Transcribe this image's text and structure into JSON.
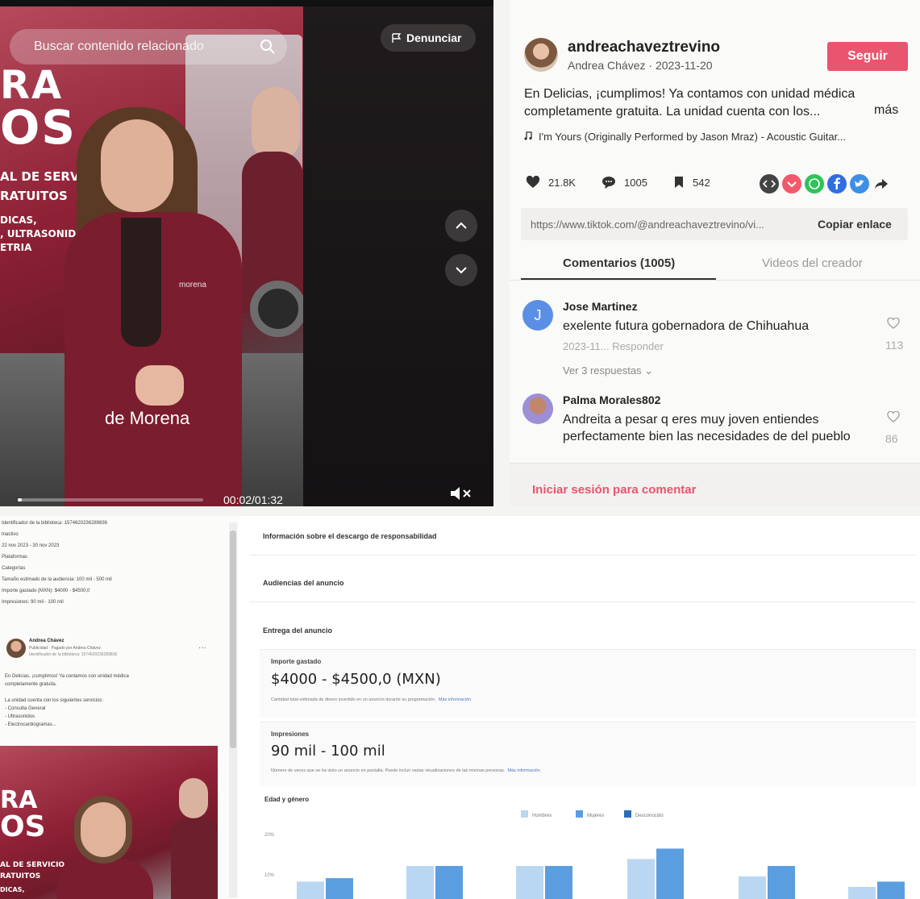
{
  "video": {
    "search_placeholder": "Buscar contenido relacionado",
    "report_label": "Denunciar",
    "caption": "de Morena",
    "time": "00:02/01:32",
    "progress": 0.02,
    "banner": {
      "ra": "RA",
      "os": "OS",
      "line1": "AL DE SERVICIO",
      "line2": "RATUITOS",
      "line3": "DICAS,",
      "line4": ", ULTRASONID",
      "line5": "ETRIA"
    },
    "jacket_text": "morena"
  },
  "post": {
    "username": "andreachaveztrevino",
    "subtitle": "Andrea Chávez · 2023-11-20",
    "follow_label": "Seguir",
    "description": "En Delicias, ¡cumplimos! Ya contamos con unidad médica completamente gratuita. La unidad cuenta con los...",
    "more_label": "más",
    "music": "I'm Yours (Originally Performed by Jason Mraz) - Acoustic Guitar...",
    "likes": "21.8K",
    "comments": "1005",
    "saves": "542",
    "link": "https://www.tiktok.com/@andreachaveztrevino/vi...",
    "copy_label": "Copiar enlace",
    "tabs": [
      "Comentarios (1005)",
      "Videos del creador"
    ],
    "comment_list": [
      {
        "initial": "J",
        "name": "Jose Martinez",
        "text": "exelente futura gobernadora de Chihuahua",
        "meta": "2023-11... Responder",
        "replies": "Ver 3 respuestas ⌄",
        "likes": "113"
      },
      {
        "initial": "",
        "name": "Palma Morales802",
        "text": "Andreita a pesar q eres muy joven entiendes perfectamente bien las necesidades de del pueblo",
        "meta": "",
        "replies": "",
        "likes": "86"
      }
    ],
    "login_label": "Iniciar sesión para comentar"
  },
  "library": {
    "lines": [
      "Identificador de la biblioteca: 1574620236289836",
      "Inactivo",
      "22 nov 2023 - 30 nov 2023",
      "Plataformas",
      "Categorías",
      "Tamaño estimado de la audiencia: 100 mil - 500 mil",
      "Importe gastado (MXN): $4000 - $4500,0",
      "Impresiones: 90 mil - 100 mil"
    ],
    "ad": {
      "name": "Andrea Chávez",
      "sponsor": "Publicidad · Pagado por Andrea Chávez",
      "libid": "Identificador de la biblioteca: 1574620236289836",
      "menu": "···",
      "body_lines": [
        "En Delicias, ¡cumplimos! Ya contamos con unidad médica",
        "completamente gratuita.",
        "",
        "La unidad cuenta con los siguientes servicios:",
        "- Consulta General",
        "- Ultrasonidos",
        "- Electrocardiogramas..."
      ]
    }
  },
  "details": {
    "sections": [
      "Información sobre el descargo de responsabilidad",
      "Audiencias del anuncio",
      "Entrega del anuncio"
    ],
    "spend_label": "Importe gastado",
    "spend_value": "$4000 - $4500,0 (MXN)",
    "spend_note": "Cantidad total estimada de dinero invertido en un anuncio durante su programación.",
    "impr_label": "Impresiones",
    "impr_value": "90 mil - 100 mil",
    "impr_note": "Número de veces que se ha visto un anuncio en pantalla. Puede incluir varias visualizaciones de las mismas personas.",
    "more_info": "Más información",
    "chart_title": "Edad y género"
  },
  "chart_data": {
    "type": "bar",
    "title": "Edad y género",
    "categories": [
      "",
      "",
      "",
      "",
      "",
      ""
    ],
    "ylim": [
      0,
      20
    ],
    "yticks": [
      "20%",
      "10%"
    ],
    "legend_position": "top",
    "series": [
      {
        "name": "Hombres",
        "color": "#b9d7f2",
        "values": [
          5,
          9.5,
          9.5,
          11.5,
          6.5,
          3.5
        ]
      },
      {
        "name": "Mujeres",
        "color": "#5a9ee0",
        "values": [
          6,
          9.5,
          9.5,
          14.5,
          9.5,
          5
        ]
      },
      {
        "name": "Desconocido",
        "color": "#2e6db5",
        "values": []
      }
    ]
  },
  "colors": {
    "accent": "#e9546e",
    "facebook": "#2f6de0",
    "whatsapp": "#2fc35a"
  }
}
